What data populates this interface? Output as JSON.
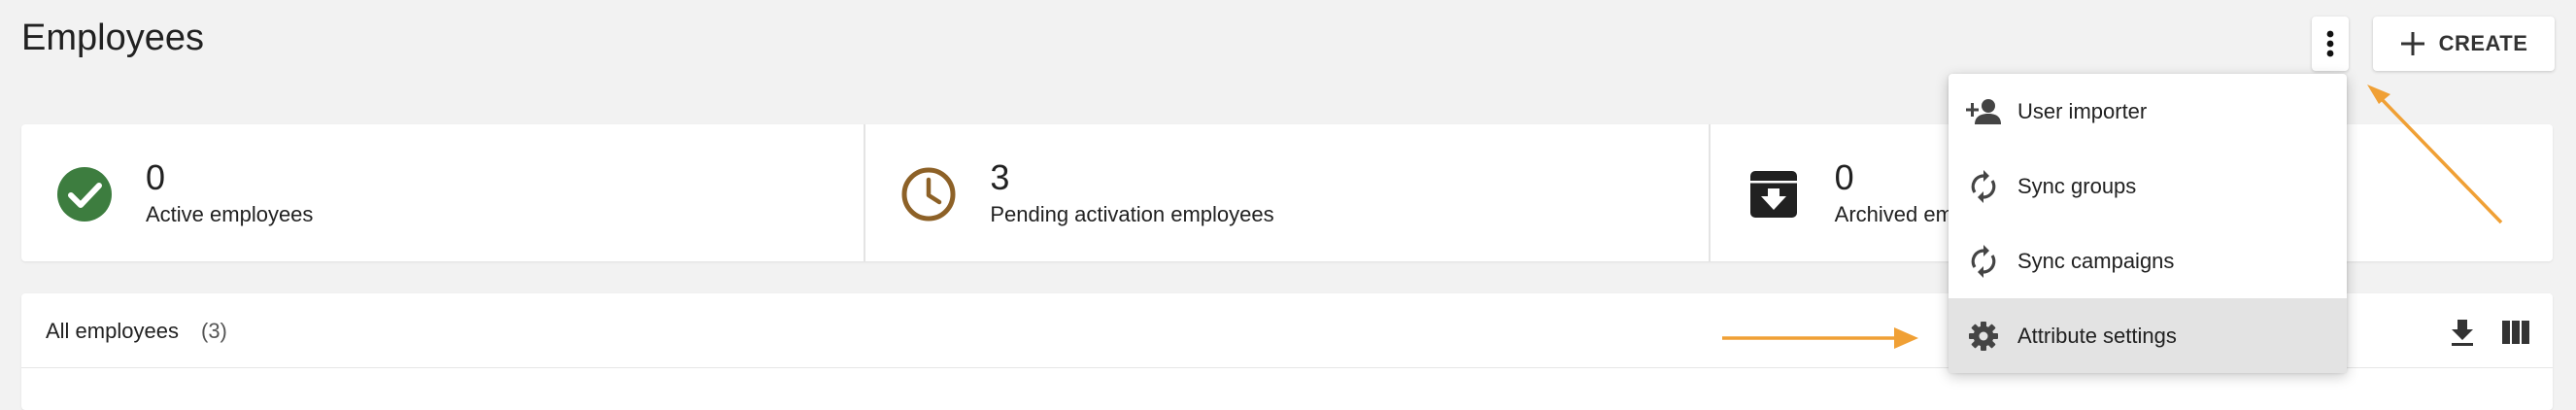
{
  "header": {
    "title": "Employees",
    "create_label": "CREATE",
    "more_icon": "more-vert-icon",
    "create_icon": "plus-icon"
  },
  "stats": [
    {
      "value": "0",
      "label": "Active employees",
      "icon": "check-circle-icon",
      "color": "#3d7d3f"
    },
    {
      "value": "3",
      "label": "Pending activation employees",
      "icon": "clock-icon",
      "color": "#8d6127"
    },
    {
      "value": "0",
      "label": "Archived employees",
      "icon": "archive-icon",
      "color": "#212121"
    }
  ],
  "list": {
    "title": "All employees",
    "count": "(3)",
    "download_icon": "download-icon",
    "columns_icon": "view-columns-icon"
  },
  "menu": {
    "items": [
      {
        "label": "User importer",
        "icon": "person-add-icon"
      },
      {
        "label": "Sync groups",
        "icon": "sync-icon"
      },
      {
        "label": "Sync campaigns",
        "icon": "sync-icon"
      },
      {
        "label": "Attribute settings",
        "icon": "gear-icon"
      }
    ]
  },
  "annotation_color": "#f0a035"
}
